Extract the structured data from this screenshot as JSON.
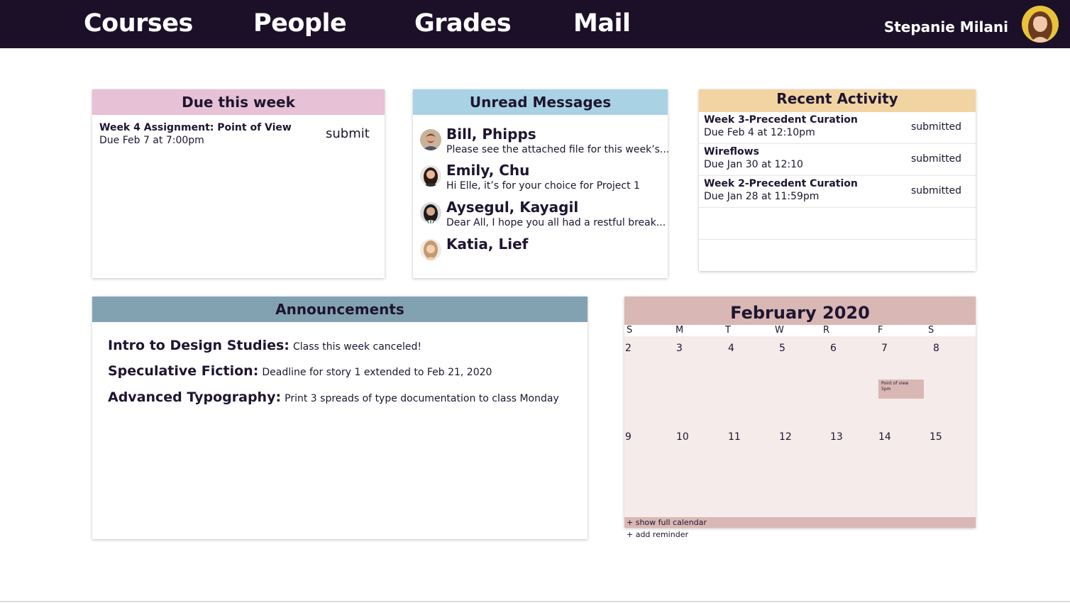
{
  "nav": {
    "items": [
      "Courses",
      "People",
      "Grades",
      "Mail"
    ],
    "user_name": "Stepanie Milani"
  },
  "due": {
    "title": "Due this week",
    "assignment": "Week 4 Assignment: Point of View",
    "date": "Due Feb 7 at 7:00pm",
    "action": "submit"
  },
  "messages": {
    "title": "Unread Messages",
    "items": [
      {
        "name": "Bill, Phipps",
        "preview": "Please see the attached file for this week’s..."
      },
      {
        "name": "Emily, Chu",
        "preview": "Hi Elle, it’s for your choice for Project 1"
      },
      {
        "name": "Aysegul, Kayagil",
        "preview": "Dear All, I hope you all had a restful break..."
      },
      {
        "name": "Katia, Lief",
        "preview": ""
      }
    ]
  },
  "recent": {
    "title": "Recent Activity",
    "items": [
      {
        "title": "Week 3-Precedent Curation",
        "date": "Due Feb 4 at 12:10pm",
        "status": "submitted"
      },
      {
        "title": "Wireflows",
        "date": "Due Jan 30 at 12:10",
        "status": "submitted"
      },
      {
        "title": "Week 2-Precedent Curation",
        "date": "Due Jan 28 at 11:59pm",
        "status": "submitted"
      }
    ]
  },
  "announcements": {
    "title": "Announcements",
    "items": [
      {
        "course": "Intro to Design Studies:",
        "text": "Class this week canceled!"
      },
      {
        "course": "Speculative Fiction:",
        "text": "Deadline for story 1 extended to Feb 21, 2020"
      },
      {
        "course": "Advanced Typography:",
        "text": "Print 3 spreads of type documentation to class Monday"
      }
    ]
  },
  "calendar": {
    "title": "February 2020",
    "weekdays": [
      "S",
      "M",
      "T",
      "W",
      "R",
      "F",
      "S"
    ],
    "week1": [
      "2",
      "3",
      "4",
      "5",
      "6",
      "7",
      "8"
    ],
    "week2": [
      "9",
      "10",
      "11",
      "12",
      "13",
      "14",
      "15"
    ],
    "event": {
      "title": "Point of view",
      "time": "5pm"
    },
    "show_full": "+ show full calendar",
    "add_reminder": "+ add reminder"
  },
  "colors": {
    "nav_bg": "#1c1029",
    "due_header": "#e7c1d6",
    "messages_header": "#a9d2e4",
    "recent_header": "#f2d4a3",
    "announcements_header": "#83a2b1",
    "calendar_header": "#d9b7b4",
    "calendar_bg": "#f5ebea"
  }
}
